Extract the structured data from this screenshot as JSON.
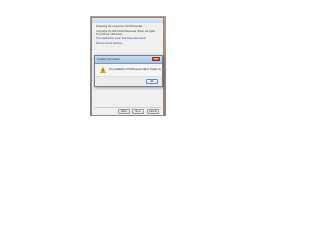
{
  "main_window": {
    "lines": [
      "Preparing the sequence of ProPresenter",
      "Copyright (C) 2007-2013 Renewed Vision, All rights reserved.",
      "To continue, click Next.",
      "This application uses: See Dependencies Required",
      "Review   Guide   Settings"
    ],
    "buttons": {
      "back": "Back",
      "next": "Next",
      "cancel": "Cancel"
    }
  },
  "dialog": {
    "title": "Installer Information",
    "close_glyph": "✕",
    "message": "The installation of ProPresenter failed. Please try again.",
    "ok_label": "OK",
    "icon": "warning-icon"
  },
  "colors": {
    "accent": "#5a8fd0",
    "warning": "#f2c200",
    "close": "#c9432b"
  }
}
